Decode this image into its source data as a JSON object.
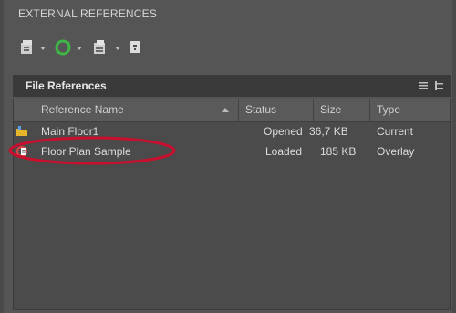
{
  "panel": {
    "title": "EXTERNAL REFERENCES"
  },
  "toolbar": {
    "buttons": [
      {
        "icon": "attach-icon"
      },
      {
        "icon": "refresh-icon"
      },
      {
        "icon": "change-path-icon"
      },
      {
        "icon": "help-icon"
      }
    ]
  },
  "file_references": {
    "title": "File References",
    "columns": [
      "Reference Name",
      "Status",
      "Size",
      "Type"
    ],
    "rows": [
      {
        "name": "Main Floor1",
        "status": "Opened",
        "size": "36,7 KB",
        "type": "Current",
        "icon": "drawing-folder-icon"
      },
      {
        "name": "Floor Plan Sample",
        "status": "Loaded",
        "size": "185 KB",
        "type": "Overlay",
        "icon": "xref-icon"
      }
    ]
  },
  "colors": {
    "panel_bg": "#555555",
    "header_bg": "#3a3a3a",
    "highlight": "#c8102e",
    "folder_yellow": "#e8b62a",
    "refresh_green": "#3fb548"
  }
}
